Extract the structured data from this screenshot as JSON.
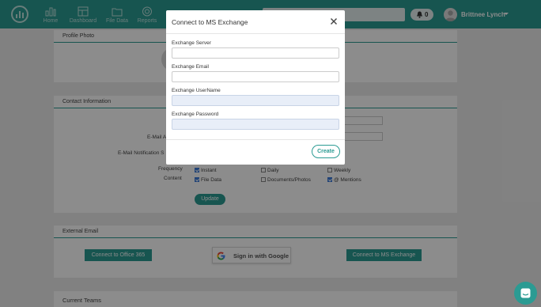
{
  "nav": {
    "items": [
      {
        "label": "Home",
        "icon": "bar-chart-icon"
      },
      {
        "label": "Dashboard",
        "icon": "dashboard-icon"
      },
      {
        "label": "File Data",
        "icon": "folder-icon"
      },
      {
        "label": "Reports",
        "icon": "target-icon"
      }
    ],
    "notifications_count": "0",
    "user_name": "Brittnee Lynch"
  },
  "profile_card": {
    "title": "Profile Photo"
  },
  "contact_card": {
    "title": "Contact Information",
    "email_label": "E-Mail A",
    "notification_label": "E-Mail Notification S",
    "frequency_label": "Frequency",
    "content_label": "Content",
    "frequency_options": [
      {
        "label": "Instant",
        "checked": true
      },
      {
        "label": "Daily",
        "checked": false
      },
      {
        "label": "Weekly",
        "checked": false
      }
    ],
    "content_options": [
      {
        "label": "File Data",
        "checked": true
      },
      {
        "label": "Documents/Photos",
        "checked": false
      },
      {
        "label": "@ Mentions",
        "checked": true
      }
    ],
    "update_label": "Update"
  },
  "external_card": {
    "title": "External Email",
    "office_btn": "Connect to Office 365",
    "google_btn": "Sign in with Google",
    "exchange_btn": "Connect to MS Exchange"
  },
  "teams_card": {
    "title": "Current Teams"
  },
  "modal": {
    "title": "Connect to MS Exchange",
    "fields": [
      {
        "label": "Exchange Server",
        "value": ""
      },
      {
        "label": "Exchange Email",
        "value": ""
      },
      {
        "label": "Exchange UserName",
        "value": ""
      },
      {
        "label": "Exchange Password",
        "value": ""
      }
    ],
    "create_label": "Create"
  },
  "colors": {
    "accent": "#2b9b93",
    "checkbox": "#3d7bd9"
  }
}
